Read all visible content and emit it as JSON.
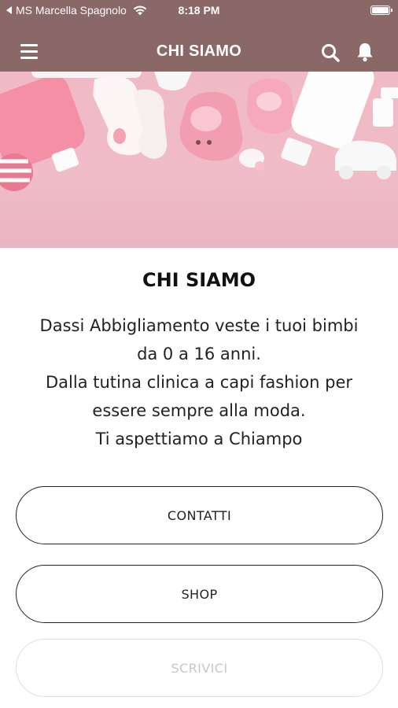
{
  "status_bar": {
    "back_label": "MS Marcella Spagnolo",
    "time": "8:18 PM"
  },
  "header": {
    "title": "CHI SIAMO"
  },
  "content": {
    "title": "CHI SIAMO",
    "lines": [
      "Dassi Abbigliamento veste i tuoi bimbi",
      "da 0 a 16 anni.",
      "Dalla tutina clinica a capi fashion per",
      "essere sempre alla moda.",
      "Ti aspettiamo a Chiampo"
    ]
  },
  "buttons": {
    "contatti": "CONTATTI",
    "shop": "SHOP",
    "scrivici": "SCRIVICI"
  },
  "colors": {
    "header_bg": "#8a6868",
    "hero_bg": "#f1b9c5"
  },
  "icons": [
    "back-triangle-icon",
    "wifi-icon",
    "battery-icon",
    "menu-icon",
    "search-icon",
    "bell-icon"
  ]
}
